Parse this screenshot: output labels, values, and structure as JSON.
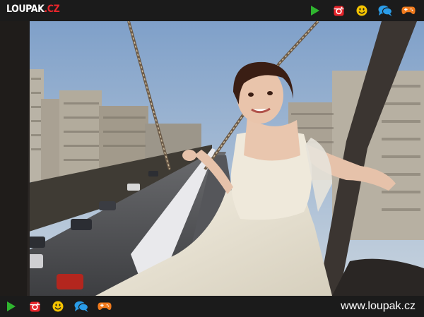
{
  "header": {
    "logo_main": "LOUPAK",
    "logo_dot": ".",
    "logo_tld": "CZ",
    "icons": [
      "play-icon",
      "instagram-icon",
      "smiley-icon",
      "chat-icon",
      "gamepad-icon"
    ]
  },
  "footer": {
    "icons": [
      "play-icon",
      "instagram-icon",
      "smiley-icon",
      "chat-icon",
      "gamepad-icon"
    ],
    "url": "www.loupak.cz"
  },
  "colors": {
    "bar_bg": "#1b1b1b",
    "play": "#2fb52f",
    "instagram": "#e8252b",
    "smiley": "#f5c400",
    "chat": "#2a9ce8",
    "gamepad": "#f07a1c"
  }
}
